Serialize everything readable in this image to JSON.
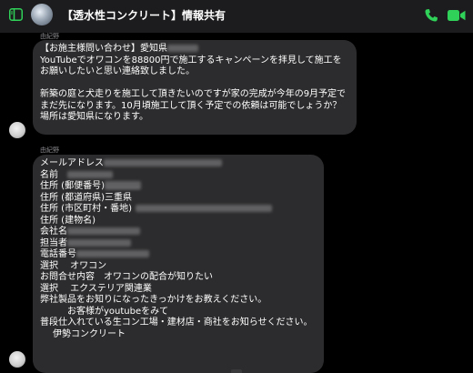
{
  "header": {
    "title": "【透水性コンクリート】情報共有",
    "icons": {
      "sidebar": "sidebar-toggle-icon",
      "call": "phone-icon",
      "video": "video-camera-icon"
    },
    "accent_color": "#30d158"
  },
  "messages": [
    {
      "sender": "由紀野",
      "lines": [
        "【お施主様問い合わせ】愛知県",
        "YouTubeでオワコンを88800円で施工するキャンペーンを拝見して施工を",
        "お願いしたいと思い連絡致しました。",
        "",
        "新築の庭と犬走りを施工して頂きたいのですが家の完成が今年の9月予定で",
        "まだ先になります。10月頃施工して頂く予定での依頼は可能でしょうか？",
        "場所は愛知県になります。"
      ]
    },
    {
      "sender": "由紀野",
      "lines": [
        "メールアドレス",
        "名前",
        "住所 (郵便番号)",
        "住所 (都道府県)三重県",
        "住所 (市区町村・番地)",
        "住所 (建物名)",
        "会社名",
        "担当者",
        "電話番号",
        "選択　 オワコン",
        "お問合せ内容　オワコンの配合が知りたい",
        "選択　 エクステリア関連業",
        "弊社製品をお知りになったきっかけをお教えください。",
        "お客様がyoutubeをみて",
        "普段仕入れている生コン工場・建材店・商社をお知らせください。",
        "伊勢コンクリート"
      ]
    }
  ],
  "colors": {
    "background": "#000000",
    "header": "#1c1c1e",
    "bubble": "#2c2c2e",
    "sender_text": "#8e8e93"
  }
}
